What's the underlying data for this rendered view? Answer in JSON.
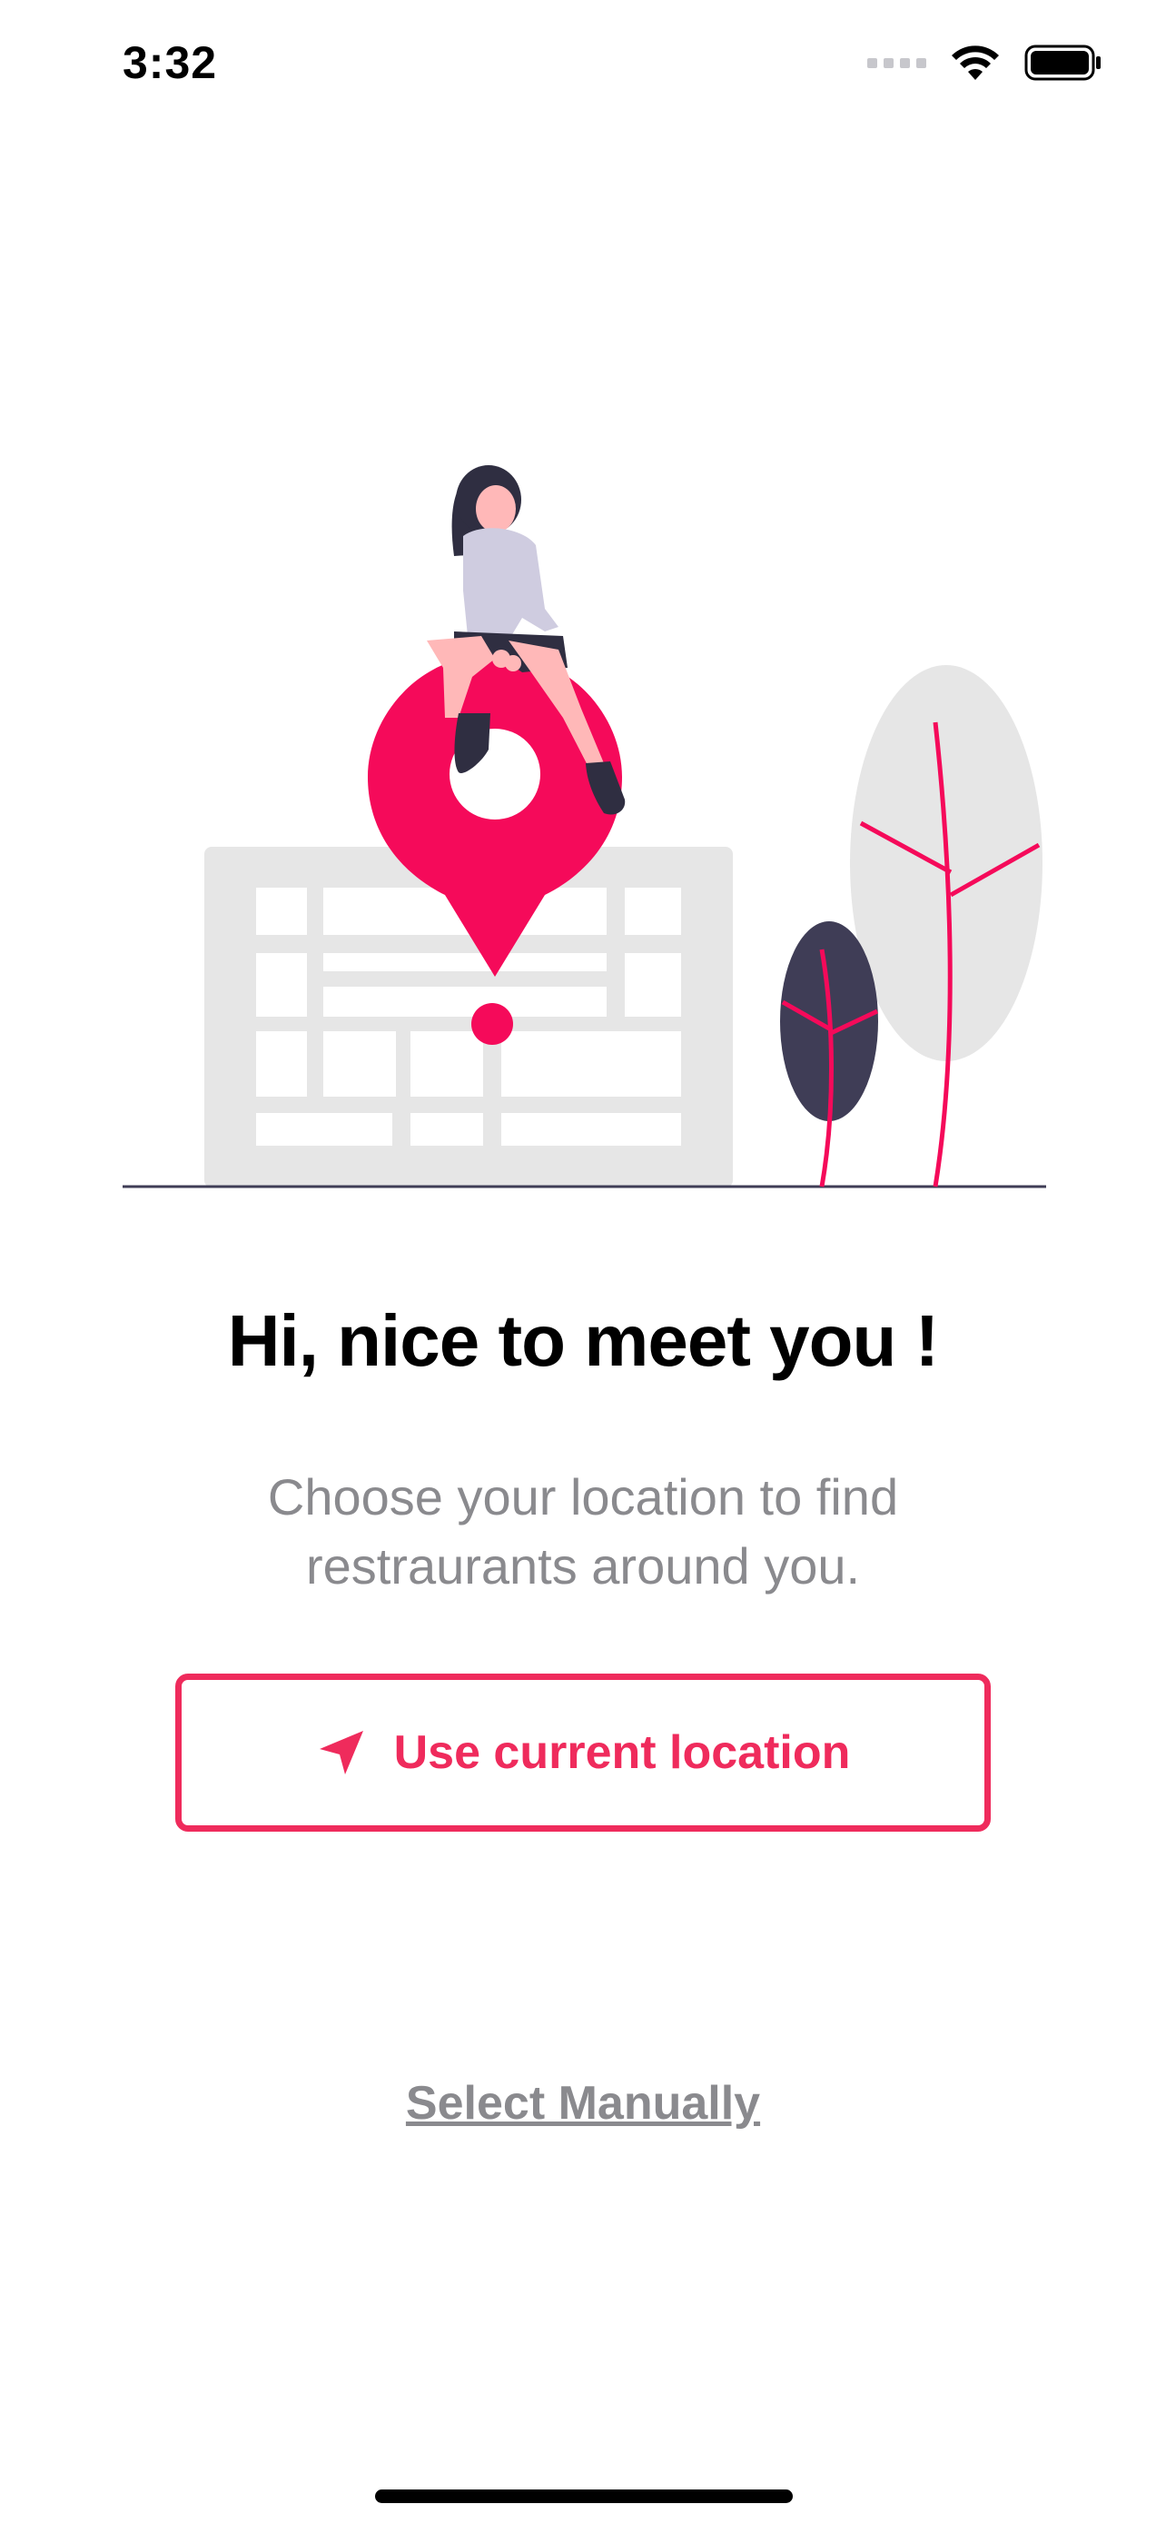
{
  "status_bar": {
    "time": "3:32",
    "icons": [
      "cellular-signal-icon",
      "wifi-icon",
      "battery-icon"
    ]
  },
  "illustration": {
    "description_icon": "woman-on-location-pin-illustration",
    "colors": {
      "accent": "#F50A5A",
      "dark": "#3F3D56",
      "light_gray": "#E6E6E6",
      "shirt": "#CFCCE0",
      "skin": "#FFB8B8"
    }
  },
  "onboarding": {
    "heading": "Hi, nice to meet you !",
    "subtitle_line1": "Choose your location to find",
    "subtitle_line2": "restraurants around you.",
    "use_location_label": "Use current location",
    "select_manually_label": "Select Manually"
  },
  "colors": {
    "accent": "#EF2B5C",
    "muted_text": "#8A8A8E",
    "text": "#000000",
    "background": "#FFFFFF"
  }
}
